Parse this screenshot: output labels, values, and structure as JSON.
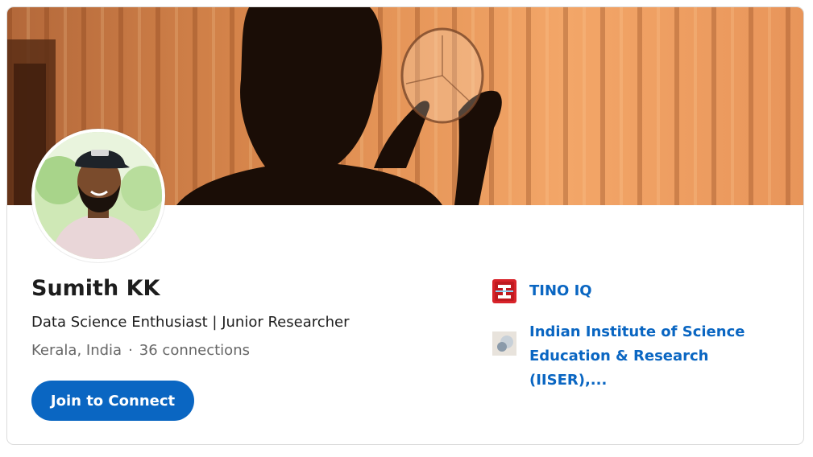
{
  "profile": {
    "name": "Sumith KK",
    "headline": "Data Science Enthusiast | Junior Researcher",
    "location": "Kerala, India",
    "separator": "·",
    "connections": "36 connections"
  },
  "actions": {
    "join_label": "Join to Connect"
  },
  "organizations": [
    {
      "name": "TINO IQ",
      "logo": "tino-iq-logo"
    },
    {
      "name": "Indian Institute of Science Education & Research (IISER),...",
      "logo": "iiser-logo"
    }
  ],
  "colors": {
    "accent": "#0a66c2",
    "text": "#1d1d1d",
    "muted": "#666666",
    "banner": "#e8924a"
  }
}
